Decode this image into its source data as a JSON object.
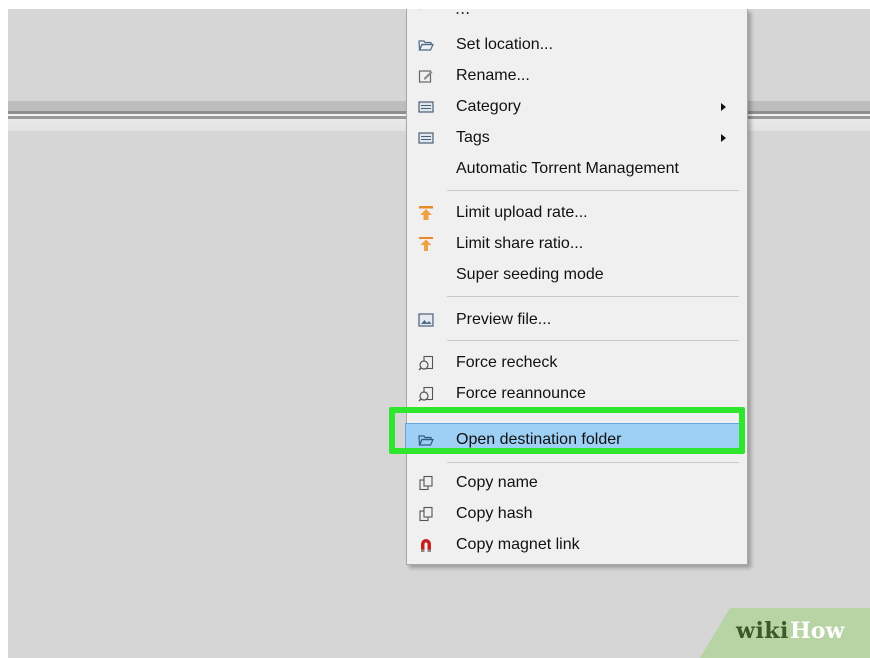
{
  "menu": {
    "partial_top_label": "...",
    "items": [
      {
        "label": "Set location...",
        "icon": "folder-open-icon"
      },
      {
        "label": "Rename...",
        "icon": "rename-icon"
      },
      {
        "label": "Category",
        "icon": "category-icon",
        "submenu": true
      },
      {
        "label": "Tags",
        "icon": "tags-icon",
        "submenu": true
      },
      {
        "label": "Automatic Torrent Management",
        "icon": ""
      },
      {
        "label": "Limit upload rate...",
        "icon": "upload-rate-icon"
      },
      {
        "label": "Limit share ratio...",
        "icon": "share-ratio-icon"
      },
      {
        "label": "Super seeding mode",
        "icon": ""
      },
      {
        "label": "Preview file...",
        "icon": "preview-icon"
      },
      {
        "label": "Force recheck",
        "icon": "recheck-icon"
      },
      {
        "label": "Force reannounce",
        "icon": "reannounce-icon"
      },
      {
        "label": "Open destination folder",
        "icon": "folder-open-icon",
        "highlighted": true
      },
      {
        "label": "Copy name",
        "icon": "copy-icon"
      },
      {
        "label": "Copy hash",
        "icon": "copy-icon"
      },
      {
        "label": "Copy magnet link",
        "icon": "magnet-icon"
      }
    ]
  },
  "watermark": {
    "wiki": "wiki",
    "how": "How"
  },
  "colors": {
    "highlight_frame": "#2ee62e",
    "selected_row": "#9ecff5",
    "menu_bg": "#f0f0f0",
    "background": "#d6d6d6"
  }
}
